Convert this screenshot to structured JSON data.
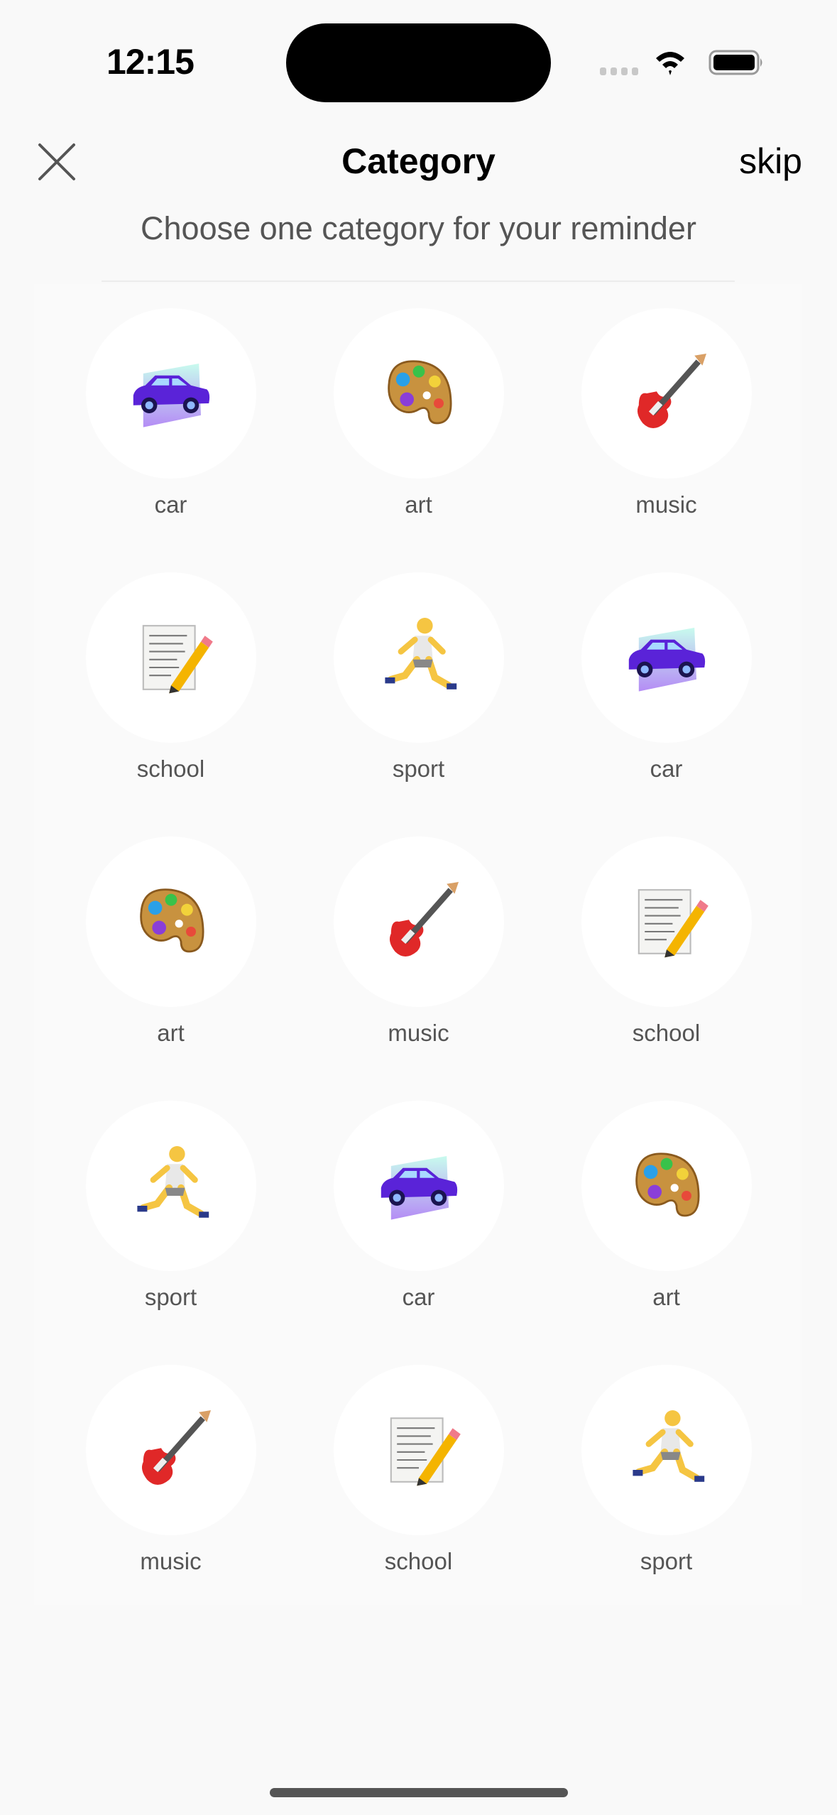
{
  "status_bar": {
    "time": "12:15"
  },
  "header": {
    "title": "Category",
    "skip_label": "skip",
    "close_icon": "close-icon"
  },
  "subtitle": "Choose one category for your reminder",
  "categories": [
    {
      "label": "car",
      "icon": "car"
    },
    {
      "label": "art",
      "icon": "art"
    },
    {
      "label": "music",
      "icon": "music"
    },
    {
      "label": "school",
      "icon": "school"
    },
    {
      "label": "sport",
      "icon": "sport"
    },
    {
      "label": "car",
      "icon": "car"
    },
    {
      "label": "art",
      "icon": "art"
    },
    {
      "label": "music",
      "icon": "music"
    },
    {
      "label": "school",
      "icon": "school"
    },
    {
      "label": "sport",
      "icon": "sport"
    },
    {
      "label": "car",
      "icon": "car"
    },
    {
      "label": "art",
      "icon": "art"
    },
    {
      "label": "music",
      "icon": "music"
    },
    {
      "label": "school",
      "icon": "school"
    },
    {
      "label": "sport",
      "icon": "sport"
    }
  ]
}
